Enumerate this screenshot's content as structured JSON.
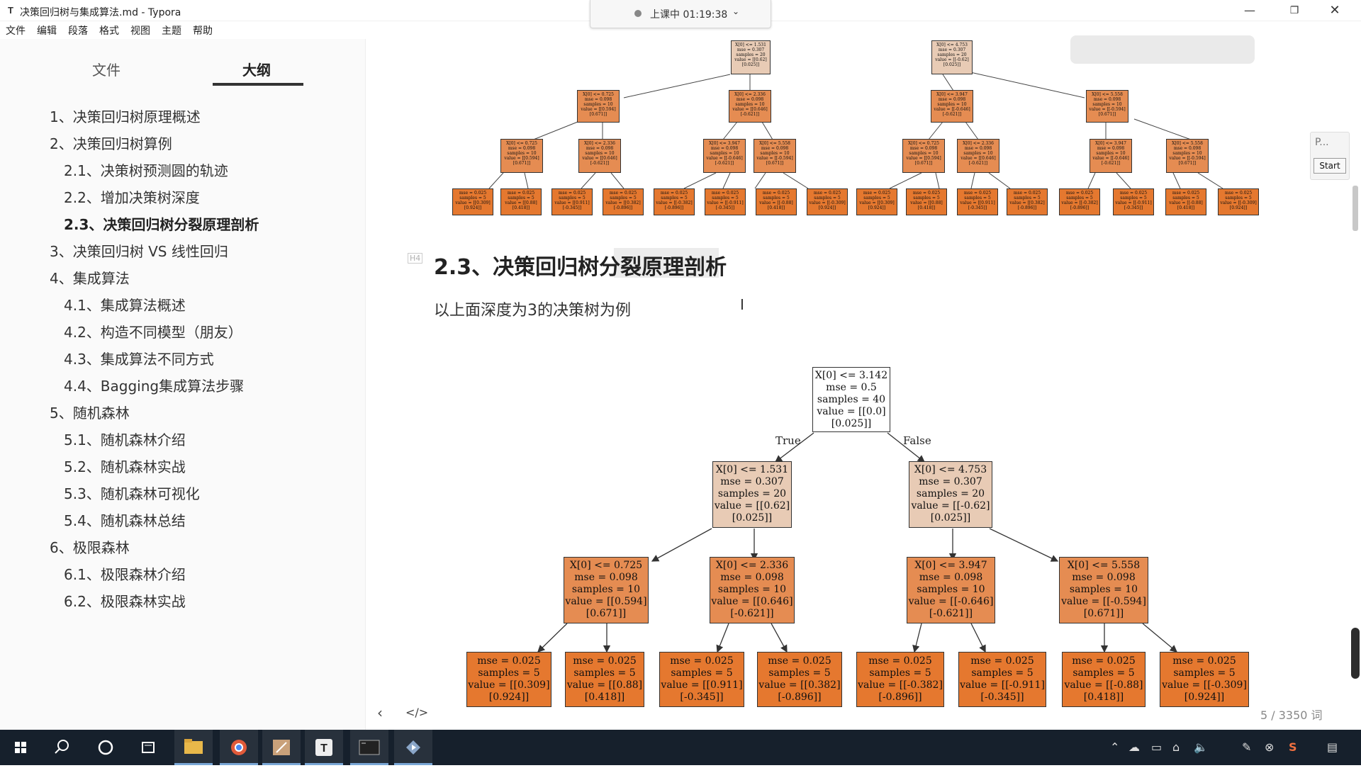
{
  "window": {
    "title": "决策回归树与集成算法.md - Typora",
    "app_icon": "T",
    "minimize": "—",
    "maximize": "❐",
    "close": "✕"
  },
  "recording": {
    "text": "上课中 01:19:38",
    "chevron": "⌄"
  },
  "menu": [
    "文件",
    "编辑",
    "段落",
    "格式",
    "视图",
    "主题",
    "帮助"
  ],
  "sidebar": {
    "tabs": {
      "files": "文件",
      "outline": "大纲"
    },
    "outline": [
      "1、决策回归树原理概述",
      "2、决策回归树算例",
      "2.1、决策树预测圆的轨迹",
      "2.2、增加决策树深度",
      "2.3、决策回归树分裂原理剖析",
      "3、决策回归树 VS 线性回归",
      "4、集成算法",
      "4.1、集成算法概述",
      "4.2、构造不同模型（朋友）",
      "4.3、集成算法不同方式",
      "4.4、Bagging集成算法步骤",
      "5、随机森林",
      "5.1、随机森林介绍",
      "5.2、随机森林实战",
      "5.3、随机森林可视化",
      "5.4、随机森林总结",
      "6、极限森林",
      "6.1、极限森林介绍",
      "6.2、极限森林实战"
    ]
  },
  "content": {
    "heading_badge": "H4",
    "heading": "2.3、决策回归树分裂原理剖析",
    "paragraph": "以上面深度为3的决策树为例",
    "cursor": "I"
  },
  "tree": {
    "root": [
      "X[0] <= 3.142",
      "mse = 0.5",
      "samples = 40",
      "value = [[0.0]",
      "[0.025]]"
    ],
    "edge_true": "True",
    "edge_false": "False",
    "level1": [
      [
        "X[0] <= 1.531",
        "mse = 0.307",
        "samples = 20",
        "value = [[0.62]",
        "[0.025]]"
      ],
      [
        "X[0] <= 4.753",
        "mse = 0.307",
        "samples = 20",
        "value = [[-0.62]",
        "[0.025]]"
      ]
    ],
    "level2": [
      [
        "X[0] <= 0.725",
        "mse = 0.098",
        "samples = 10",
        "value = [[0.594]",
        "[0.671]]"
      ],
      [
        "X[0] <= 2.336",
        "mse = 0.098",
        "samples = 10",
        "value = [[0.646]",
        "[-0.621]]"
      ],
      [
        "X[0] <= 3.947",
        "mse = 0.098",
        "samples = 10",
        "value = [[-0.646]",
        "[-0.621]]"
      ],
      [
        "X[0] <= 5.558",
        "mse = 0.098",
        "samples = 10",
        "value = [[-0.594]",
        "[0.671]]"
      ]
    ],
    "leaves": [
      [
        "mse = 0.025",
        "samples = 5",
        "value = [[0.309]",
        "[0.924]]"
      ],
      [
        "mse = 0.025",
        "samples = 5",
        "value = [[0.88]",
        "[0.418]]"
      ],
      [
        "mse = 0.025",
        "samples = 5",
        "value = [[0.911]",
        "[-0.345]]"
      ],
      [
        "mse = 0.025",
        "samples = 5",
        "value = [[0.382]",
        "[-0.896]]"
      ],
      [
        "mse = 0.025",
        "samples = 5",
        "value = [[-0.382]",
        "[-0.896]]"
      ],
      [
        "mse = 0.025",
        "samples = 5",
        "value = [[-0.911]",
        "[-0.345]]"
      ],
      [
        "mse = 0.025",
        "samples = 5",
        "value = [[-0.88]",
        "[0.418]]"
      ],
      [
        "mse = 0.025",
        "samples = 5",
        "value = [[-0.309]",
        "[0.924]]"
      ]
    ],
    "node_colors": {
      "root": "#ffffff",
      "level1": "#e8cbb5",
      "level2": "#e58c52",
      "leaf": "#e5782f"
    }
  },
  "statusbar": {
    "prev": "‹",
    "source": "</>",
    "word_count": "5 / 3350 词"
  },
  "float_panel": {
    "label": "P...",
    "start": "Start"
  },
  "taskbar": {
    "icons": [
      "windows-icon",
      "search-icon",
      "cortana-icon",
      "task-view-icon",
      "file-explorer-icon",
      "chrome-icon",
      "paint-icon",
      "typora-icon",
      "terminal-icon",
      "video-icon"
    ],
    "tray": [
      "⌃",
      "☁",
      "▭",
      "⌂",
      "🔈",
      "✎",
      "⊗",
      "S",
      "▤"
    ]
  }
}
